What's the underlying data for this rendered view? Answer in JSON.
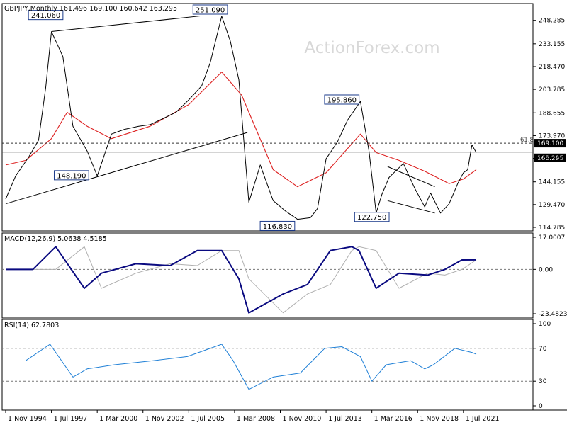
{
  "watermark": "ActionForex.com",
  "colors": {
    "price": "#000000",
    "ma": "#dd2020",
    "macd": "#0a0a80",
    "signal": "#b0b0b0",
    "rsi": "#1e7fd6",
    "label_border": "#1b3a8a",
    "grid": "#777777"
  },
  "chart_data": [
    {
      "type": "line",
      "panel": "price",
      "title": "GBPJPY,Monthly  161.496 169.100 160.642 163.295",
      "x_ticks": [
        "1 Nov 1994",
        "1 Jul 1997",
        "1 Mar 2000",
        "1 Nov 2002",
        "1 Jul 2005",
        "1 Mar 2008",
        "1 Nov 2010",
        "1 Jul 2013",
        "1 Mar 2016",
        "1 Nov 2018",
        "1 Jul 2021"
      ],
      "y_ticks": [
        "248.285",
        "233.155",
        "218.470",
        "203.785",
        "188.655",
        "173.970",
        "159.285",
        "144.155",
        "129.470",
        "114.785"
      ],
      "ylim": [
        114.785,
        255
      ],
      "current_price_label": "163.295",
      "high_label": "169.100",
      "fib_label": "61.8",
      "series": [
        {
          "x": [
            "1994-11",
            "1995-06",
            "1996-03",
            "1996-10",
            "1997-03",
            "1997-07",
            "1998-03",
            "1998-10",
            "1999-08",
            "2000-03",
            "2001-01",
            "2001-10",
            "2002-08",
            "2003-04",
            "2004-01",
            "2004-10",
            "2005-07",
            "2006-04",
            "2006-10",
            "2007-06",
            "2007-12",
            "2008-06",
            "2009-01",
            "2009-09",
            "2010-06",
            "2011-03",
            "2011-11",
            "2012-08",
            "2013-01",
            "2013-07",
            "2014-03",
            "2014-10",
            "2015-07",
            "2016-01",
            "2016-06",
            "2016-10",
            "2017-03",
            "2018-01",
            "2018-09",
            "2019-04",
            "2019-08",
            "2020-03",
            "2020-09",
            "2021-03",
            "2021-07",
            "2021-10",
            "2022-01",
            "2022-04"
          ],
          "values": [
            133,
            148,
            160,
            171,
            205,
            241,
            225,
            180,
            164,
            148,
            175,
            178,
            180,
            181,
            185,
            189,
            197,
            206,
            221,
            251,
            235,
            210,
            131,
            155,
            132,
            125,
            120,
            121,
            127,
            159,
            170,
            184,
            196,
            164,
            124,
            136,
            147,
            156,
            140,
            128,
            137,
            124,
            130,
            143,
            150,
            152,
            168,
            163
          ]
        },
        {
          "x": [
            "1994-11",
            "1996-01",
            "1997-07",
            "1998-06",
            "1999-08",
            "2001-01",
            "2003-04",
            "2005-07",
            "2007-06",
            "2008-08",
            "2010-06",
            "2011-11",
            "2013-07",
            "2015-07",
            "2016-06",
            "2017-10",
            "2019-04",
            "2020-09",
            "2021-07",
            "2022-04"
          ],
          "values": [
            155,
            158,
            172,
            189,
            180,
            172,
            180,
            194,
            215,
            200,
            152,
            141,
            150,
            175,
            163,
            158,
            151,
            143,
            146,
            152
          ]
        }
      ],
      "annotations": [
        "241.060",
        "251.090",
        "148.190",
        "195.860",
        "116.830",
        "122.750"
      ]
    },
    {
      "type": "line",
      "panel": "macd",
      "title": "MACD(12,26,9) 5.0638 4.5185",
      "y_ticks": [
        "17.0007",
        "0.00",
        "-23.4823"
      ],
      "ylim": [
        -23.4823,
        17.0007
      ],
      "series": [
        {
          "x": [
            "1994-11",
            "1996-06",
            "1997-10",
            "1999-06",
            "2000-06",
            "2002-06",
            "2004-06",
            "2006-01",
            "2007-06",
            "2008-06",
            "2009-01",
            "2011-01",
            "2012-06",
            "2013-10",
            "2015-01",
            "2015-06",
            "2016-06",
            "2017-10",
            "2019-06",
            "2020-06",
            "2021-06",
            "2022-04"
          ],
          "values": [
            0,
            0,
            12,
            -10,
            -2,
            3,
            2,
            10,
            10,
            -5,
            -23,
            -13,
            -8,
            10,
            12,
            10,
            -10,
            -2,
            -3,
            0,
            5,
            5.06
          ]
        }
      ]
    },
    {
      "type": "line",
      "panel": "rsi",
      "title": "RSI(14) 62.7803",
      "y_ticks": [
        "100",
        "70",
        "30",
        "0"
      ],
      "ylim": [
        0,
        100
      ],
      "series": [
        {
          "x": [
            "1996-01",
            "1997-06",
            "1998-10",
            "1999-08",
            "2001-03",
            "2003-06",
            "2005-06",
            "2007-06",
            "2008-02",
            "2009-01",
            "2010-06",
            "2012-01",
            "2013-06",
            "2014-06",
            "2015-07",
            "2016-03",
            "2017-01",
            "2018-06",
            "2019-04",
            "2019-10",
            "2021-01",
            "2022-01",
            "2022-04"
          ],
          "values": [
            55,
            75,
            35,
            45,
            50,
            55,
            60,
            75,
            55,
            20,
            35,
            40,
            70,
            72,
            60,
            30,
            50,
            55,
            45,
            50,
            70,
            65,
            62.78
          ]
        }
      ]
    }
  ]
}
